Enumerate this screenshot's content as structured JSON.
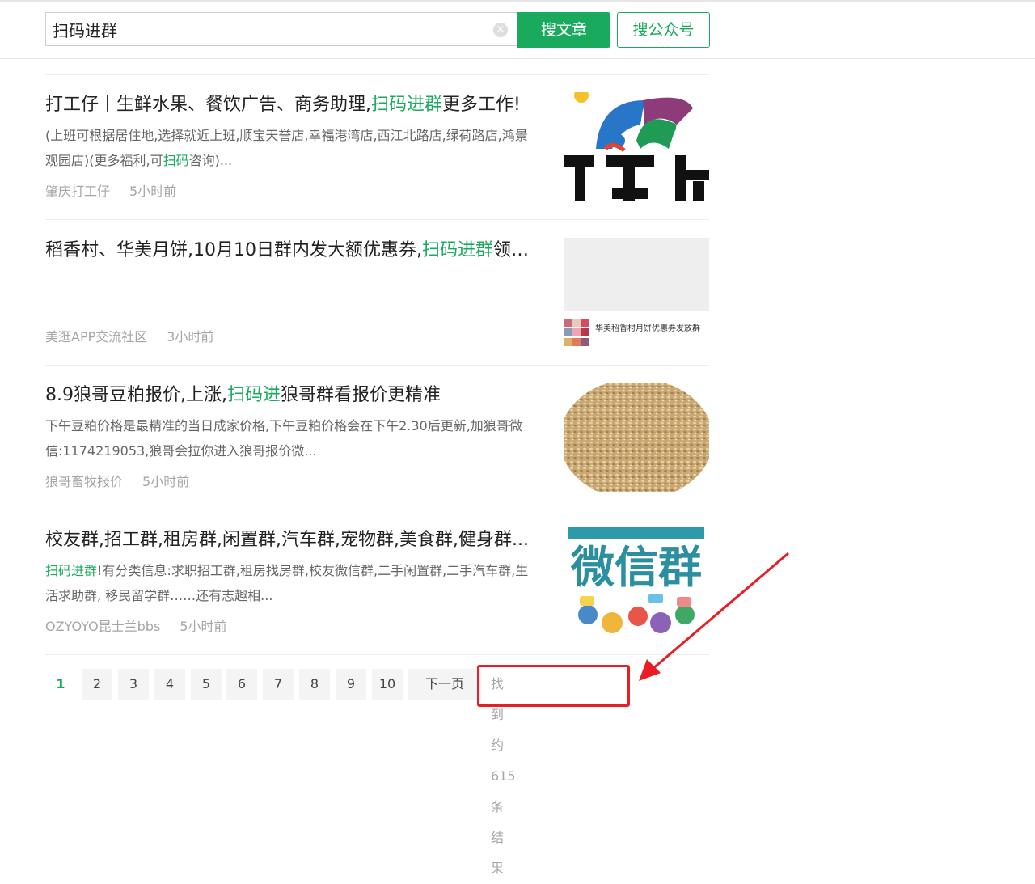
{
  "search": {
    "query": "扫码进群",
    "clear_icon": "×",
    "article_button": "搜文章",
    "account_button": "搜公众号"
  },
  "results": [
    {
      "title_before": "打工仔丨生鲜水果、餐饮广告、商务助理,",
      "title_highlight": "扫码进群",
      "title_after": "更多工作!",
      "desc_before": "(上班可根据居住地,选择就近上班,顺宝天誉店,幸福港湾店,西江北路店,绿荷路店,鸿景观园店)(更多福利,可",
      "desc_highlight": "扫码",
      "desc_after": "咨询)...",
      "source": "肇庆打工仔",
      "time": "5小时前"
    },
    {
      "title_before": "稻香村、华美月饼,10月10日群内发大额优惠券,",
      "title_highlight": "扫码进群",
      "title_after": "领取！",
      "desc_before": "",
      "desc_highlight": "",
      "desc_after": "",
      "source": "美逛APP交流社区",
      "time": "3小时前",
      "thumb_caption": "华美稻香村月饼优惠券发放群"
    },
    {
      "title_before": "8.9狼哥豆粕报价,上涨,",
      "title_highlight": "扫码进",
      "title_after": "狼哥群看报价更精准",
      "desc_before": "下午豆粕价格是最精准的当日成家价格,下午豆粕价格会在下午2.30后更新,加狼哥微信:1174219053,狼哥会拉你进入狼哥报价微...",
      "desc_highlight": "",
      "desc_after": "",
      "source": "狼哥畜牧报价",
      "time": "5小时前"
    },
    {
      "title_before": "校友群,招工群,租房群,闲置群,汽车群,宠物群,美食群,健身群...",
      "title_highlight": "",
      "title_after": "",
      "desc_before": "",
      "desc_highlight": "扫码进群",
      "desc_after": "!有分类信息:求职招工群,租房找房群,校友微信群,二手闲置群,二手汽车群,生活求助群, 移民留学群……还有志趣相...",
      "source": "OZYOYO昆士兰bbs",
      "time": "5小时前",
      "thumb_text": "微信群"
    }
  ],
  "pagination": {
    "pages": [
      "1",
      "2",
      "3",
      "4",
      "5",
      "6",
      "7",
      "8",
      "9",
      "10"
    ],
    "current": "1",
    "next": "下一页",
    "total": "找到约615条结果"
  },
  "colors": {
    "accent": "#1aaa5e",
    "annotation": "#ea1c24"
  }
}
